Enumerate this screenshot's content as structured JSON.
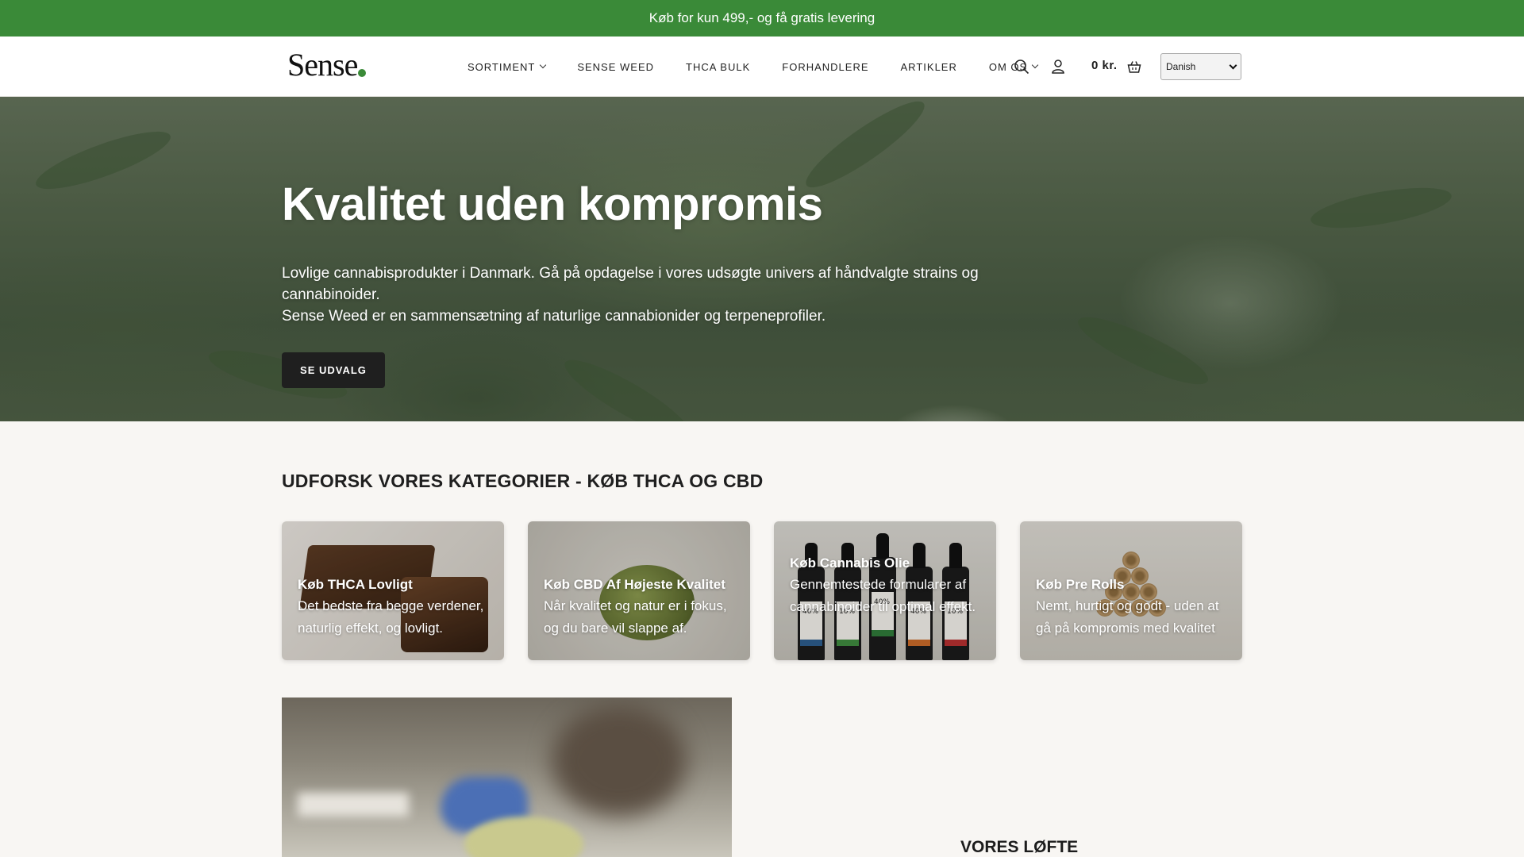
{
  "announcement": "Køb for kun 499,- og få gratis levering",
  "header": {
    "logo": "Sense",
    "nav": [
      {
        "label": "SORTIMENT",
        "dropdown": true
      },
      {
        "label": "SENSE WEED",
        "dropdown": false
      },
      {
        "label": "THCA BULK",
        "dropdown": false
      },
      {
        "label": "FORHANDLERE",
        "dropdown": false
      },
      {
        "label": "ARTIKLER",
        "dropdown": false
      },
      {
        "label": "OM OS",
        "dropdown": true
      }
    ],
    "icons": [
      "search-icon",
      "user-icon",
      "cart-icon"
    ],
    "cart_total": "0 kr.",
    "language": "Danish"
  },
  "hero": {
    "title": "Kvalitet uden kompromis",
    "subtitle_line1": "Lovlige cannabisprodukter i Danmark. Gå på opdagelse i vores udsøgte univers af håndvalgte strains og cannabinoider.",
    "subtitle_line2": "Sense Weed er en sammensætning af naturlige cannabionider og terpeneprofiler.",
    "cta": "SE UDVALG"
  },
  "categories": {
    "title": "UDFORSK VORES KATEGORIER - KØB THCA OG CBD",
    "items": [
      {
        "title": "Køb THCA Lovligt",
        "desc": "Det bedste fra begge verdener, naturlig effekt, og lovligt."
      },
      {
        "title": "Køb CBD Af Højeste Kvalitet",
        "desc": "Når kvalitet og natur er i fokus, og du bare vil slappe af."
      },
      {
        "title": "Køb Cannabis Olie",
        "desc": "Gennemtestede formularer af cannabinoider til optimal effekt."
      },
      {
        "title": "Køb Pre Rolls",
        "desc": "Nemt, hurtigt og godt - uden at gå på kompromis med kvalitet"
      }
    ],
    "bottle_labels": [
      "40%",
      "10%",
      "40%",
      "40%",
      "10%"
    ]
  },
  "promise": {
    "title": "VORES LØFTE"
  },
  "colors": {
    "brand_green": "#3a8a38",
    "button_dark": "#1f1f1f"
  }
}
